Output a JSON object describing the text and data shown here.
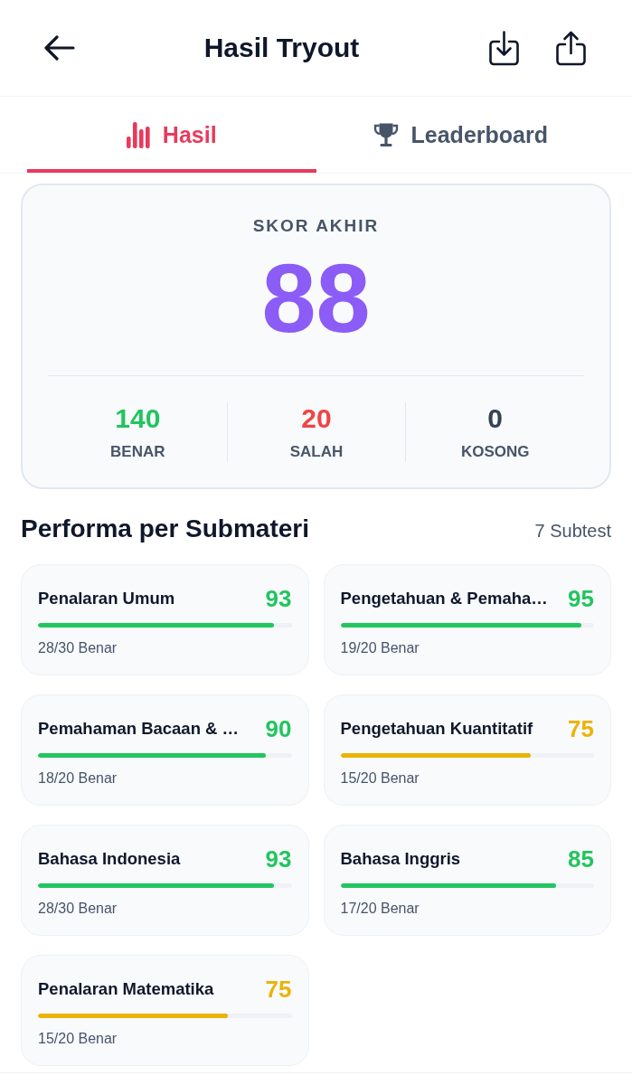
{
  "header": {
    "title": "Hasil Tryout"
  },
  "tabs": [
    {
      "label": "Hasil",
      "selected": true,
      "kind": "chart"
    },
    {
      "label": "Leaderboard",
      "selected": false,
      "kind": "trophy"
    }
  ],
  "score_card": {
    "label": "SKOR AKHIR",
    "score": "88",
    "stats": [
      {
        "value": "140",
        "label": "BENAR",
        "color": "#22c55e"
      },
      {
        "value": "20",
        "label": "SALAH",
        "color": "#ef4444"
      },
      {
        "value": "0",
        "label": "KOSONG",
        "color": "#334155"
      }
    ]
  },
  "section": {
    "title": "Performa per Submateri",
    "count": "7 Subtest"
  },
  "subtests": [
    {
      "name": "Penalaran Umum",
      "score": "93",
      "level": 0.93,
      "color": "#22c55e",
      "detail": "28/30 Benar"
    },
    {
      "name": "Pengetahuan & Pemaha…",
      "score": "95",
      "level": 0.95,
      "color": "#22c55e",
      "detail": "19/20 Benar"
    },
    {
      "name": "Pemahaman Bacaan & …",
      "score": "90",
      "level": 0.9,
      "color": "#22c55e",
      "detail": "18/20 Benar"
    },
    {
      "name": "Pengetahuan Kuantitatif",
      "score": "75",
      "level": 0.75,
      "color": "#eab308",
      "detail": "15/20 Benar"
    },
    {
      "name": "Bahasa Indonesia",
      "score": "93",
      "level": 0.93,
      "color": "#22c55e",
      "detail": "28/30 Benar"
    },
    {
      "name": "Bahasa Inggris",
      "score": "85",
      "level": 0.85,
      "color": "#22c55e",
      "detail": "17/20 Benar"
    },
    {
      "name": "Penalaran Matematika",
      "score": "75",
      "level": 0.75,
      "color": "#eab308",
      "detail": "15/20 Benar"
    }
  ]
}
